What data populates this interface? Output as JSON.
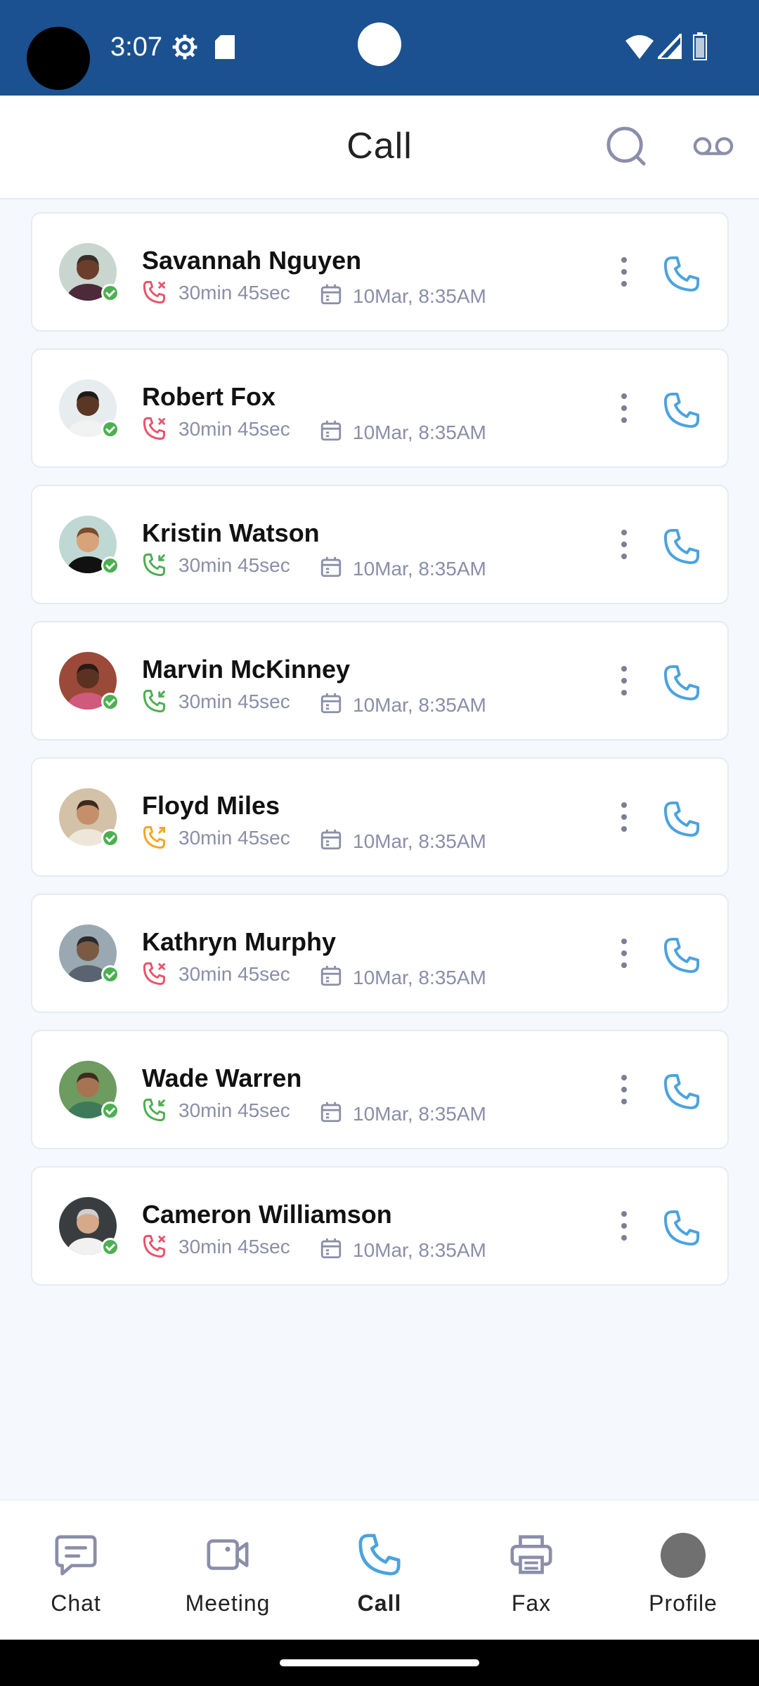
{
  "status_bar": {
    "time": "3:07",
    "icons": [
      "gear-icon",
      "sd-card-icon",
      "wifi-icon",
      "signal-icon",
      "battery-icon"
    ]
  },
  "header": {
    "title": "Call",
    "search_icon": "search-icon",
    "voicemail_icon": "voicemail-icon"
  },
  "colors": {
    "status_bar": "#1b5190",
    "accent": "#4aa3df",
    "missed": "#e8546b",
    "incoming": "#4caf50",
    "outgoing": "#f5a623",
    "meta_text": "#8a8ea8"
  },
  "calls": [
    {
      "name": "Savannah Nguyen",
      "type": "missed",
      "duration": "30min 45sec",
      "datetime": "10Mar, 8:35AM",
      "online": true
    },
    {
      "name": "Robert Fox",
      "type": "missed",
      "duration": "30min 45sec",
      "datetime": "10Mar, 8:35AM",
      "online": true
    },
    {
      "name": "Kristin Watson",
      "type": "incoming",
      "duration": "30min 45sec",
      "datetime": "10Mar, 8:35AM",
      "online": true
    },
    {
      "name": "Marvin McKinney",
      "type": "incoming",
      "duration": "30min 45sec",
      "datetime": "10Mar, 8:35AM",
      "online": true
    },
    {
      "name": "Floyd Miles",
      "type": "outgoing",
      "duration": "30min 45sec",
      "datetime": "10Mar, 8:35AM",
      "online": true
    },
    {
      "name": "Kathryn Murphy",
      "type": "missed",
      "duration": "30min 45sec",
      "datetime": "10Mar, 8:35AM",
      "online": true
    },
    {
      "name": "Wade Warren",
      "type": "incoming",
      "duration": "30min 45sec",
      "datetime": "10Mar, 8:35AM",
      "online": true
    },
    {
      "name": "Cameron Williamson",
      "type": "missed",
      "duration": "30min 45sec",
      "datetime": "10Mar, 8:35AM",
      "online": true
    }
  ],
  "bottom_nav": {
    "items": [
      {
        "label": "Chat",
        "icon": "chat-icon",
        "active": false
      },
      {
        "label": "Meeting",
        "icon": "video-camera-icon",
        "active": false
      },
      {
        "label": "Call",
        "icon": "phone-icon",
        "active": true
      },
      {
        "label": "Fax",
        "icon": "printer-icon",
        "active": false
      },
      {
        "label": "Profile",
        "icon": "avatar",
        "active": false
      }
    ]
  }
}
